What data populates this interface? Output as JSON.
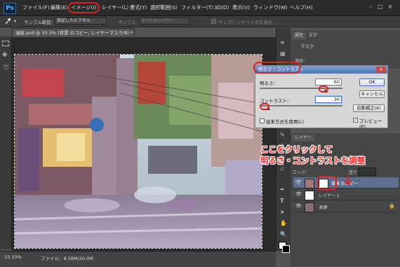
{
  "app": {
    "logo": "Ps"
  },
  "menu": [
    "ファイル(F)",
    "編集(E)",
    "イメージ(I)",
    "レイヤー(L)",
    "書式(Y)",
    "選択範囲(S)",
    "フィルター(T)",
    "3D(D)",
    "表示(V)",
    "ウィンドウ(W)",
    "ヘルプ(H)"
  ],
  "window_controls": [
    "–",
    "□",
    "×"
  ],
  "options": {
    "sample_size_label": "サンプル範囲：",
    "sample_size_value": "指定したピクセル",
    "sample_label": "サンプル：",
    "sample_value": "すべてのレイヤー",
    "sampling_ring": "サンプリングリングを表示"
  },
  "document": {
    "tab_title": "油絵.psd @ 33.3% (背景 のコピー, レイヤーマスク/8) *",
    "tab_close": "×"
  },
  "status": {
    "zoom": "33.33%",
    "file_info": "ファイル：8.58M/20.0M"
  },
  "properties_panel": {
    "tabs": [
      "属性",
      "文字"
    ],
    "mask_label": "マスク",
    "density_label": "濃度："
  },
  "dialog": {
    "title": "明るさ・コントラスト",
    "brightness_label": "明るさ：",
    "brightness_value": "60",
    "contrast_label": "コントラスト：",
    "contrast_value": "30",
    "legacy_label": "従来方式を使用(L)",
    "ok": "OK",
    "cancel": "キャンセル",
    "auto": "自動補正(A)",
    "preview": "プレビュー(P)",
    "brightness_level": 0.8,
    "contrast_level": 0.1
  },
  "layers_panel": {
    "tab": "レイヤー",
    "lock_label": "ロック：",
    "fill_label": "塗り：",
    "layers": [
      {
        "name": "背景 のコピー",
        "selected": true
      },
      {
        "name": "レイヤー 1",
        "selected": false
      },
      {
        "name": "背景",
        "selected": false
      }
    ]
  },
  "annotation": {
    "line1": "ここをクリックして",
    "line2": "明るさ・コントラストを調整"
  },
  "colors": {
    "accent_red": "#e02020",
    "dialog_blue": "#4d74b6",
    "selected_layer": "#5c6f8f"
  }
}
